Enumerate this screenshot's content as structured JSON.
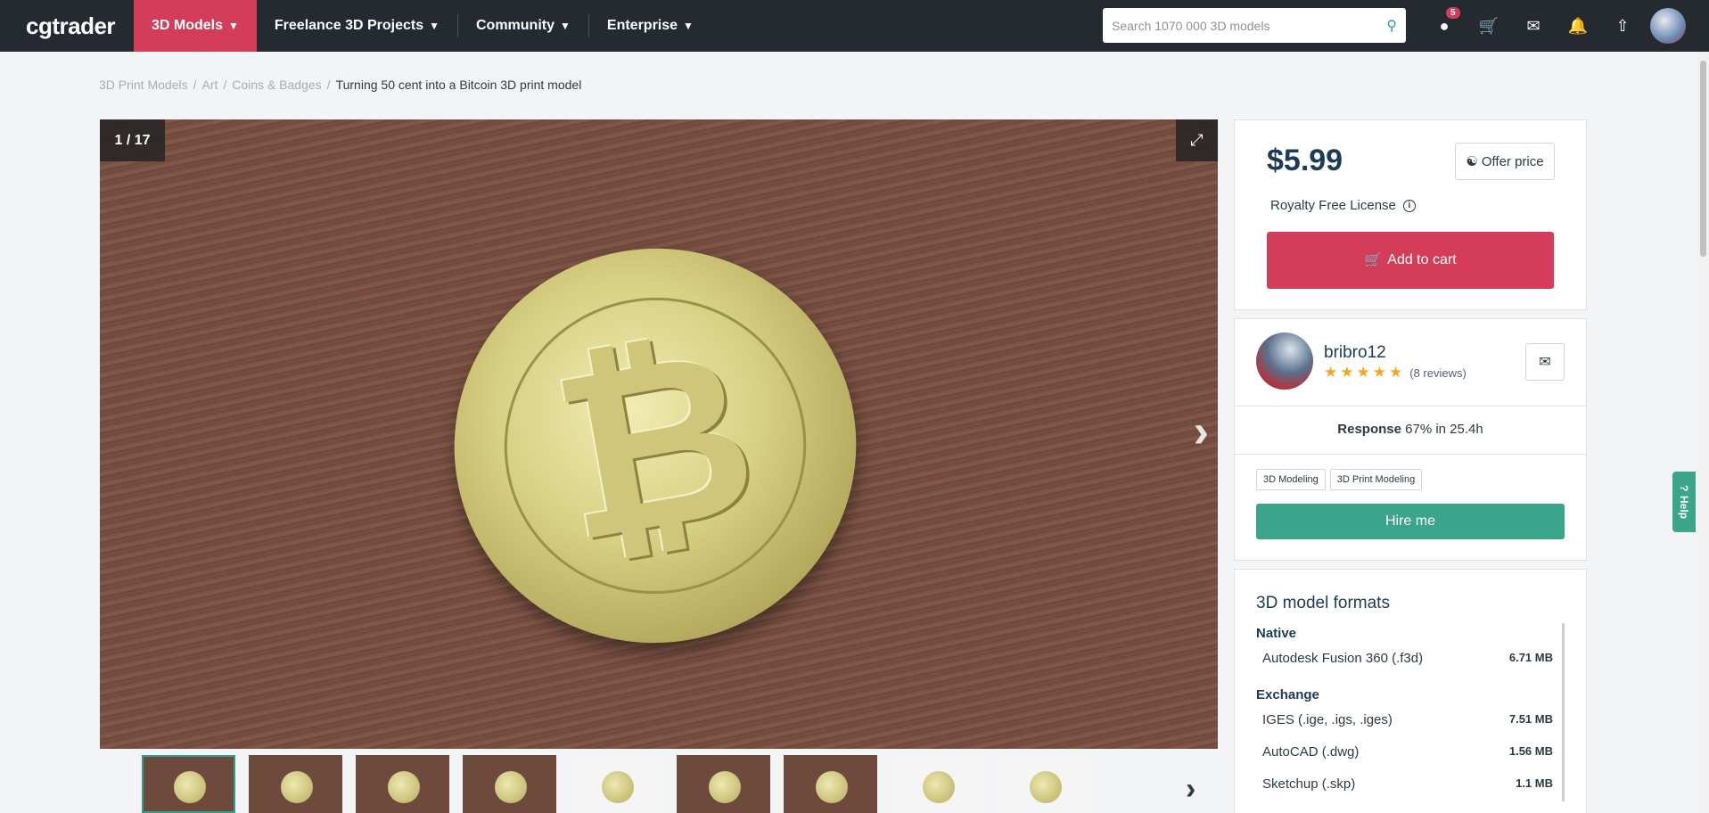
{
  "nav": {
    "logo": "cgtrader",
    "items": [
      {
        "label": "3D Models"
      },
      {
        "label": "Freelance 3D Projects"
      },
      {
        "label": "Community"
      },
      {
        "label": "Enterprise"
      }
    ],
    "search_placeholder": "Search 1070 000 3D models",
    "notifications_count": "5",
    "icons": [
      "piggy-bank-icon",
      "cart-icon",
      "mail-icon",
      "bell-icon",
      "upload-icon"
    ]
  },
  "breadcrumb": {
    "items": [
      "3D Print Models",
      "Art",
      "Coins & Badges"
    ],
    "current": "Turning 50 cent into a Bitcoin 3D print model"
  },
  "gallery": {
    "counter": "1 / 17",
    "thumb_count": 9
  },
  "pricing": {
    "price": "$5.99",
    "offer_label": "Offer price",
    "license": "Royalty Free License",
    "cart_label": "Add to cart"
  },
  "seller": {
    "name": "bribro12",
    "rating": 5,
    "reviews": "(8 reviews)",
    "response_label": "Response",
    "response_value": "67% in 25.4h",
    "tags": [
      "3D Modeling",
      "3D Print Modeling"
    ],
    "hire_label": "Hire me"
  },
  "formats": {
    "title": "3D model formats",
    "groups": [
      {
        "name": "Native",
        "items": [
          {
            "name": "Autodesk Fusion 360 (.f3d)",
            "size": "6.71 MB"
          }
        ]
      },
      {
        "name": "Exchange",
        "items": [
          {
            "name": "IGES (.ige, .igs, .iges)",
            "size": "7.51 MB"
          },
          {
            "name": "AutoCAD (.dwg)",
            "size": "1.56 MB"
          },
          {
            "name": "Sketchup (.skp)",
            "size": "1.1 MB"
          }
        ]
      }
    ]
  },
  "help_label": "Help"
}
